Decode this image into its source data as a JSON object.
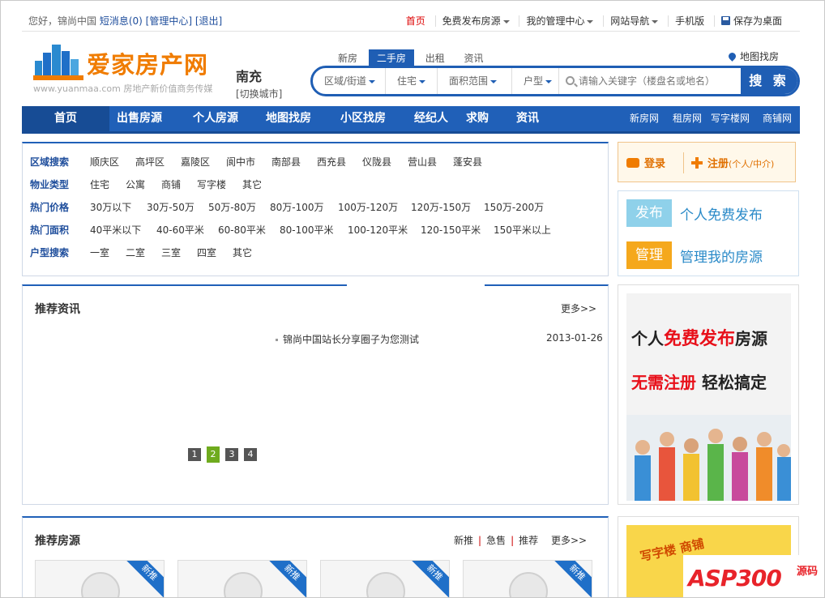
{
  "topbar": {
    "greeting": "您好，锦尚中国",
    "messages": "短消息(0)",
    "admin": "[管理中心]",
    "logout": "[退出]",
    "links": [
      "首页",
      "免费发布房源",
      "我的管理中心",
      "网站导航",
      "手机版",
      "保存为桌面"
    ]
  },
  "logo": {
    "brand": "爱家房产网",
    "slogan": "www.yuanmaa.com 房地产新价值商务传媒"
  },
  "city": {
    "name": "南充",
    "switch": "[切换城市]"
  },
  "search": {
    "tabs": [
      "新房",
      "二手房",
      "出租",
      "资讯"
    ],
    "active_tab": "二手房",
    "selects": [
      "区域/街道",
      "住宅",
      "面积范围",
      "户型"
    ],
    "placeholder": "请输入关键字（楼盘名或地名）",
    "button": "搜 索",
    "map_link": "地图找房"
  },
  "nav": {
    "main": [
      "首页",
      "出售房源",
      "个人房源",
      "地图找房",
      "小区找房",
      "经纪人",
      "求购",
      "资讯"
    ],
    "sub": [
      "新房网",
      "租房网",
      "写字楼网",
      "商铺网"
    ]
  },
  "filters": [
    {
      "label": "区域搜索",
      "options": [
        "顺庆区",
        "高坪区",
        "嘉陵区",
        "阆中市",
        "南部县",
        "西充县",
        "仪陇县",
        "营山县",
        "蓬安县"
      ]
    },
    {
      "label": "物业类型",
      "options": [
        "住宅",
        "公寓",
        "商铺",
        "写字楼",
        "其它"
      ]
    },
    {
      "label": "热门价格",
      "options": [
        "30万以下",
        "30万-50万",
        "50万-80万",
        "80万-100万",
        "100万-120万",
        "120万-150万",
        "150万-200万"
      ]
    },
    {
      "label": "热门面积",
      "options": [
        "40平米以下",
        "40-60平米",
        "60-80平米",
        "80-100平米",
        "100-120平米",
        "120-150平米",
        "150平米以上"
      ]
    },
    {
      "label": "户型搜索",
      "options": [
        "一室",
        "二室",
        "三室",
        "四室",
        "其它"
      ]
    }
  ],
  "news": {
    "title": "推荐资讯",
    "more": "更多>>",
    "items": [
      {
        "title": "锦尚中国站长分享圈子为您测试",
        "date": "2013-01-26"
      }
    ],
    "pages": [
      "1",
      "2",
      "3",
      "4"
    ],
    "current_page": "2"
  },
  "houses": {
    "title": "推荐房源",
    "tabs": [
      "新推",
      "急售",
      "推荐"
    ],
    "more": "更多>>",
    "ribbon": "新推"
  },
  "account": {
    "login": "登录",
    "register": "注册",
    "register_note": "(个人/中介)"
  },
  "actions": [
    {
      "badge": "发布",
      "text": "个人免费发布",
      "color": "#8fd1ea"
    },
    {
      "badge": "管理",
      "text": "管理我的房源",
      "color": "#f5a81c"
    }
  ],
  "ad": {
    "line1_a": "个人",
    "line1_b": "免费发布",
    "line1_c": "房源",
    "line2_a": "无需注册",
    "line2_b": "轻松搞定"
  },
  "ad2": {
    "text": "写字楼 商铺"
  },
  "watermark": {
    "brand": "ASP300",
    "suffix": "源码"
  },
  "colors": {
    "primary": "#2060b8",
    "accent": "#f07c00",
    "link": "#1f4e9c"
  }
}
